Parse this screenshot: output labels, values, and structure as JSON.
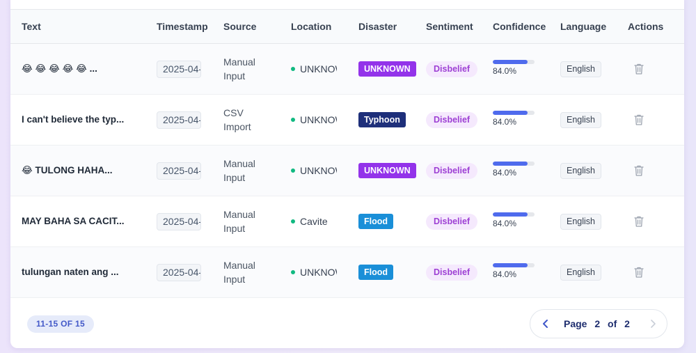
{
  "columns": [
    "Text",
    "Timestamp",
    "Source",
    "Location",
    "Disaster",
    "Sentiment",
    "Confidence",
    "Language",
    "Actions"
  ],
  "rows": [
    {
      "text": "😂 😂 😂 😂 😂 ...",
      "timestamp": "2025-04-",
      "source": "Manual Input",
      "location": "UNKNOWN",
      "disaster": "UNKNOWN",
      "disaster_color": "#9333ea",
      "sentiment": "Disbelief",
      "confidence_label": "84.0%",
      "confidence": 0.84,
      "language": "English"
    },
    {
      "text": "I can't believe the typ...",
      "timestamp": "2025-04-",
      "source": "CSV Import",
      "location": "UNKNOWN",
      "disaster": "Typhoon",
      "disaster_color": "#1e2f7a",
      "sentiment": "Disbelief",
      "confidence_label": "84.0%",
      "confidence": 0.84,
      "language": "English"
    },
    {
      "text": "😂 TULONG HAHA...",
      "timestamp": "2025-04-",
      "source": "Manual Input",
      "location": "UNKNOWN",
      "disaster": "UNKNOWN",
      "disaster_color": "#9333ea",
      "sentiment": "Disbelief",
      "confidence_label": "84.0%",
      "confidence": 0.84,
      "language": "English"
    },
    {
      "text": "MAY BAHA SA CACIT...",
      "timestamp": "2025-04-",
      "source": "Manual Input",
      "location": "Cavite",
      "disaster": "Flood",
      "disaster_color": "#1a8fd8",
      "sentiment": "Disbelief",
      "confidence_label": "84.0%",
      "confidence": 0.84,
      "language": "English"
    },
    {
      "text": "tulungan naten ang ...",
      "timestamp": "2025-04-",
      "source": "Manual Input",
      "location": "UNKNOWN",
      "disaster": "Flood",
      "disaster_color": "#1a8fd8",
      "sentiment": "Disbelief",
      "confidence_label": "84.0%",
      "confidence": 0.84,
      "language": "English"
    }
  ],
  "footer": {
    "count_label": "11-15 OF 15",
    "page_word": "Page",
    "current_page": "2",
    "of_word": "of",
    "total_pages": "2"
  },
  "icons": {
    "delete": "trash-icon",
    "prev": "chevron-left-icon",
    "next": "chevron-right-icon"
  }
}
